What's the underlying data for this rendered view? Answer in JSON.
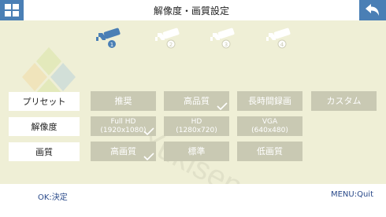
{
  "header": {
    "title": "解像度・画質設定"
  },
  "rows": {
    "preset": {
      "label": "プリセット",
      "options": [
        "推奨",
        "高品質",
        "長時間録画",
        "カスタム"
      ]
    },
    "resolution": {
      "label": "解像度",
      "options": [
        {
          "line1": "Full HD",
          "line2": "(1920x1080)"
        },
        {
          "line1": "HD",
          "line2": "(1280x720)"
        },
        {
          "line1": "VGA",
          "line2": "(640x480)"
        }
      ]
    },
    "quality": {
      "label": "画質",
      "options": [
        "高画質",
        "標準",
        "低画質"
      ]
    }
  },
  "cameras": [
    {
      "number": "1",
      "active": true
    },
    {
      "number": "2",
      "active": false
    },
    {
      "number": "3",
      "active": false
    },
    {
      "number": "4",
      "active": false
    }
  ],
  "footer": {
    "ok": "OK:決定",
    "menu": "MENU:Quit"
  },
  "colors": {
    "accent": "#4a7fb5",
    "option_bg": "#c9c9b3",
    "content_bg": "#efefd6"
  }
}
